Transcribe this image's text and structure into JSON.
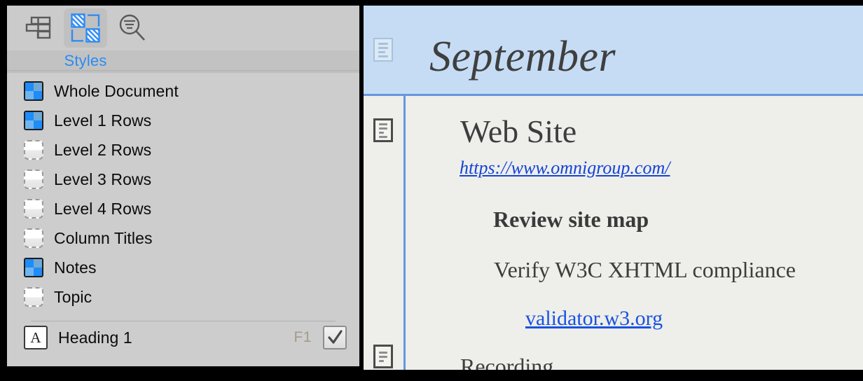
{
  "sidebar": {
    "toolbar": {
      "buttons": [
        {
          "name": "outline-view",
          "icon": "outline-icon",
          "active": false
        },
        {
          "name": "styles-view",
          "icon": "styles-checker-icon",
          "active": true
        },
        {
          "name": "search-view",
          "icon": "search-filter-icon",
          "active": false
        }
      ],
      "active_tab_label": "Styles"
    },
    "styles": [
      {
        "label": "Whole Document",
        "icon": "style-swatch-filled-icon",
        "filled": true
      },
      {
        "label": "Level 1 Rows",
        "icon": "style-swatch-filled-icon",
        "filled": true
      },
      {
        "label": "Level 2 Rows",
        "icon": "style-swatch-empty-icon",
        "filled": false
      },
      {
        "label": "Level 3 Rows",
        "icon": "style-swatch-empty-icon",
        "filled": false
      },
      {
        "label": "Level 4 Rows",
        "icon": "style-swatch-empty-icon",
        "filled": false
      },
      {
        "label": "Column Titles",
        "icon": "style-swatch-empty-icon",
        "filled": false
      },
      {
        "label": "Notes",
        "icon": "style-swatch-filled-icon",
        "filled": true
      },
      {
        "label": "Topic",
        "icon": "style-swatch-empty-icon",
        "filled": false
      }
    ],
    "named_style": {
      "label": "Heading 1",
      "icon_glyph": "A",
      "shortcut": "F1",
      "checked": true,
      "check_glyph": "✓"
    }
  },
  "document": {
    "selected_row": {
      "text": "September",
      "handle_icon": "note-row-handle-icon",
      "selected": true
    },
    "rows": [
      {
        "text": "Web Site",
        "level": 1,
        "style": "heading"
      },
      {
        "text": "https://www.omnigroup.com/",
        "level": 2,
        "style": "link-italic"
      },
      {
        "text": "Review site map",
        "level": 2,
        "style": "bold"
      },
      {
        "text": "Verify W3C XHTML compliance",
        "level": 2,
        "style": "plain"
      },
      {
        "text": "validator.w3.org",
        "level": 3,
        "style": "link"
      },
      {
        "text": "Recording",
        "level": 1,
        "style": "heading-clipped"
      }
    ]
  },
  "colors": {
    "accent_blue": "#2b8cf0",
    "selection_blue": "#c5dcf4",
    "rule_blue": "#6597de",
    "link_blue": "#1344d6",
    "paper": "#eeeeea",
    "sidebar_gray": "#cdcdcd"
  }
}
